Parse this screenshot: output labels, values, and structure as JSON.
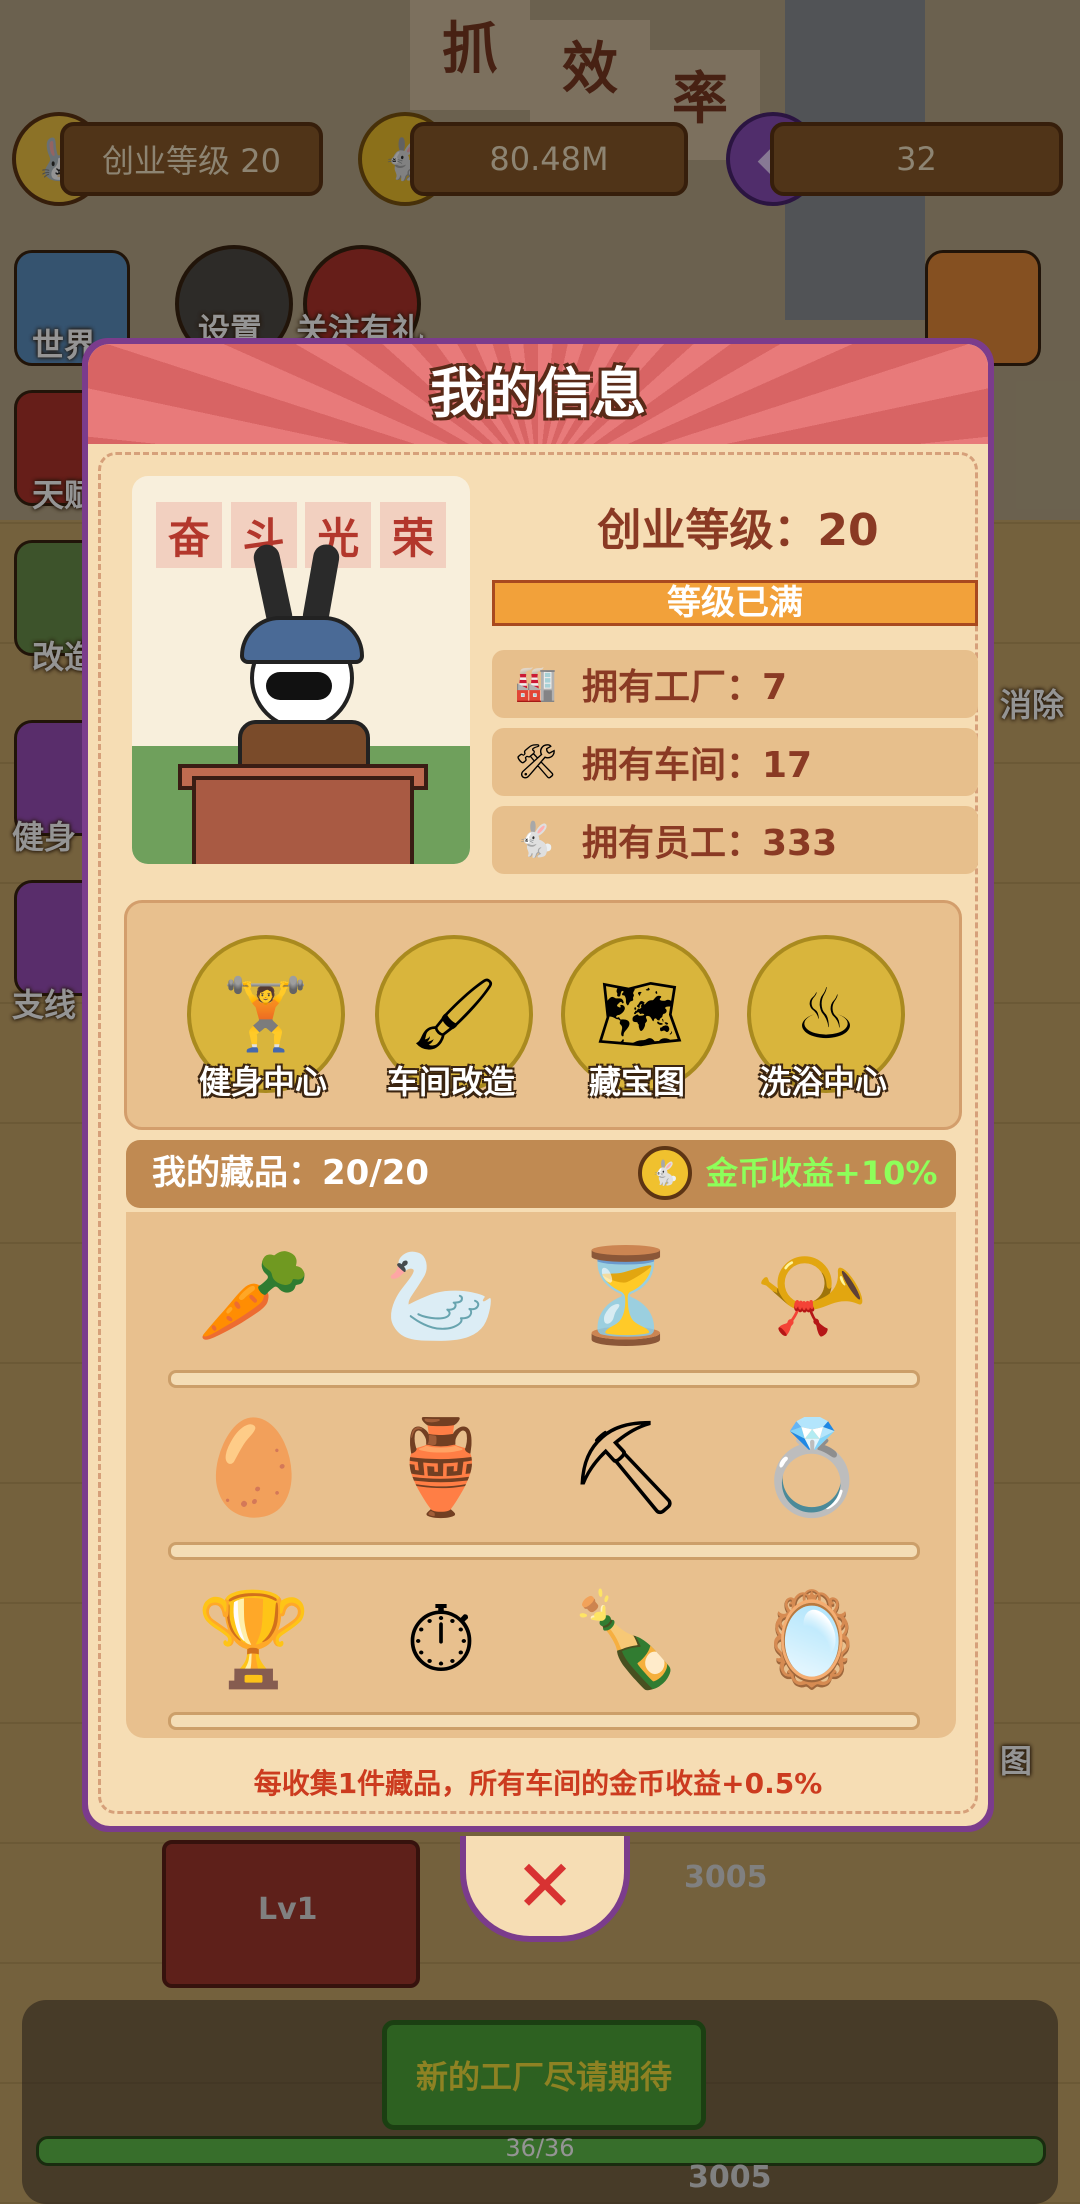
{
  "hud": {
    "level_label": "创业等级 20",
    "coins": "80.48M",
    "gems": "32"
  },
  "background": {
    "banner_chars": [
      "抓",
      "效",
      "率"
    ],
    "side_labels": [
      "世界",
      "设置",
      "关注有礼",
      "天赋",
      "改造",
      "健身",
      "支线",
      "消除",
      "图"
    ],
    "workstation_level": "Lv1",
    "new_factory_button": "新的工厂尽请期待",
    "progress_text": "36/36",
    "counter_1": "3005",
    "counter_2": "3005"
  },
  "modal": {
    "title": "我的信息",
    "slogan": [
      "奋",
      "斗",
      "光",
      "荣"
    ],
    "level_text": "创业等级：20",
    "max_level_text": "等级已满",
    "stats": [
      {
        "icon": "factory-icon",
        "label": "拥有工厂：7"
      },
      {
        "icon": "workshop-icon",
        "label": "拥有车间：17"
      },
      {
        "icon": "employees-icon",
        "label": "拥有员工：333"
      }
    ],
    "features": [
      {
        "label": "健身中心",
        "icon": "gym-icon"
      },
      {
        "label": "车间改造",
        "icon": "paint-roller-icon"
      },
      {
        "label": "藏宝图",
        "icon": "treasure-map-icon"
      },
      {
        "label": "洗浴中心",
        "icon": "bathhouse-icon"
      }
    ],
    "collection": {
      "title": "我的藏品：20/20",
      "bonus": "金币收益+10%",
      "items": [
        "golden-carrot-icon",
        "crystal-swans-icon",
        "hourglass-icon",
        "jeweled-horn-icon",
        "golden-egg-icon",
        "jeweled-vase-icon",
        "golden-shovel-icon",
        "golden-ring-icon",
        "silver-trophy-icon",
        "pocket-watch-icon",
        "message-bottle-icon",
        "hand-mirror-icon"
      ]
    },
    "footer_note": "每收集1件藏品，所有车间的金币收益+0.5%",
    "close_symbol": "✕"
  },
  "colors": {
    "accent_purple": "#7b3c8c",
    "header_red": "#e87a7a",
    "panel_cream": "#f6ddb4",
    "bonus_green": "#8dff5a",
    "note_red": "#cc3b1f"
  }
}
